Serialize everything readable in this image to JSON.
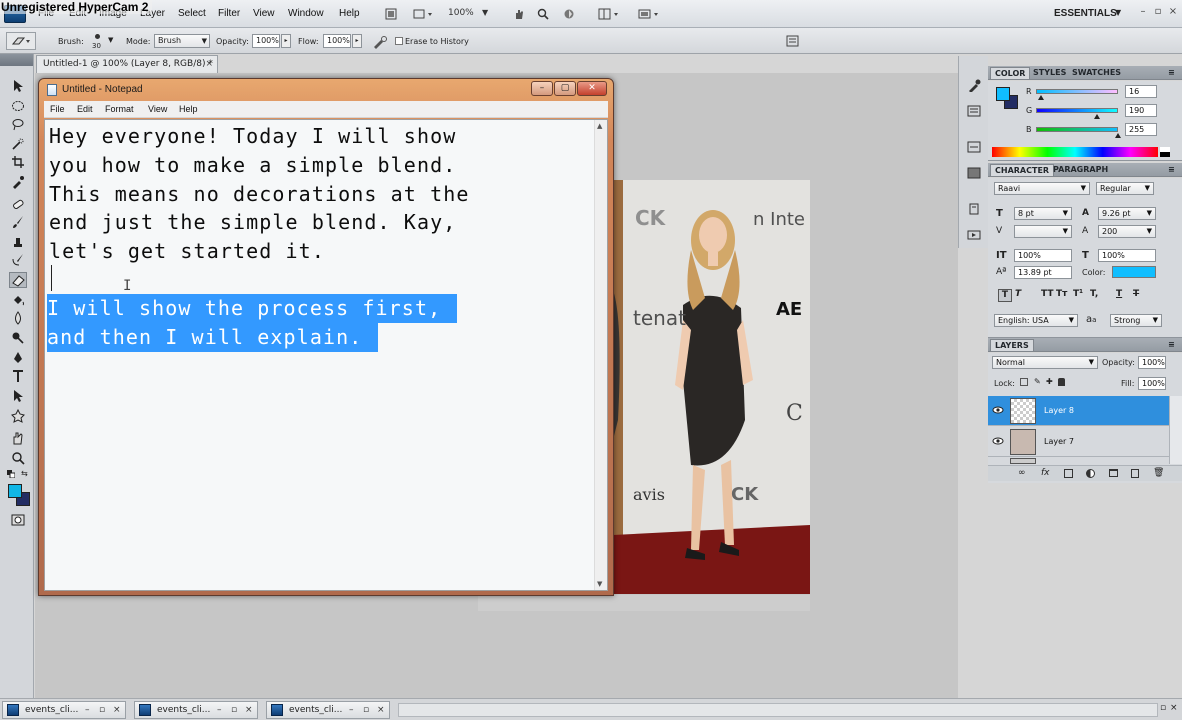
{
  "watermark": "Unregistered HyperCam 2",
  "ps_menus": [
    "File",
    "Edit",
    "Image",
    "Layer",
    "Select",
    "Filter",
    "View",
    "Window",
    "Help"
  ],
  "appbar": {
    "zoom": "100%",
    "workspace": "ESSENTIALS"
  },
  "options": {
    "brush_label": "Brush:",
    "brush_size": "30",
    "mode_label": "Mode:",
    "mode_value": "Brush",
    "opacity_label": "Opacity:",
    "opacity_value": "100%",
    "flow_label": "Flow:",
    "flow_value": "100%",
    "erase_history_label": "Erase to History"
  },
  "document_tab": {
    "title": "Untitled-1 @ 100% (Layer 8, RGB/8) *",
    "close": "×"
  },
  "notepad": {
    "title": "Untitled - Notepad",
    "menus": [
      "File",
      "Edit",
      "Format",
      "View",
      "Help"
    ],
    "text": "Hey everyone! Today I will show\nyou how to make a simple blend.\nThis means no decorations at the\nend just the simple blend. Kay,\nlet's get started it.",
    "selected_lines": [
      "I will show the process first,",
      "and then I will explain."
    ]
  },
  "color_panel": {
    "tabs": [
      "COLOR",
      "STYLES",
      "SWATCHES"
    ],
    "r_label": "R",
    "r_value": "16",
    "g_label": "G",
    "g_value": "190",
    "b_label": "B",
    "b_value": "255",
    "r_level": 16,
    "g_level": 190,
    "b_level": 255,
    "foreground_color": "#10beff"
  },
  "character_panel": {
    "tabs": [
      "CHARACTER",
      "PARAGRAPH"
    ],
    "font_family": "Raavi",
    "font_style": "Regular",
    "size": "8 pt",
    "leading": "9.26 pt",
    "tracking": "200",
    "vscale": "100%",
    "hscale": "100%",
    "baseline": "13.89 pt",
    "color_label": "Color:",
    "text_color": "#10beff",
    "style_buttons": [
      "T",
      "T",
      "TT",
      "Tт",
      "T¹",
      "T,",
      "T",
      "T"
    ],
    "language": "English: USA",
    "aa_label": "a",
    "antialias": "Strong"
  },
  "layers_panel": {
    "tab": "LAYERS",
    "blend_mode": "Normal",
    "opacity_label": "Opacity:",
    "opacity": "100%",
    "lock_label": "Lock:",
    "fill_label": "Fill:",
    "fill": "100%",
    "layers": [
      {
        "name": "Layer 8",
        "selected": true
      },
      {
        "name": "Layer 7",
        "selected": false
      }
    ]
  },
  "taskbar": {
    "tasks": [
      "events_cli...",
      "events_cli...",
      "events_cli..."
    ]
  },
  "colors": {
    "selection": "#3399ff",
    "layer_selected": "#2f8fdd",
    "notepad_frame": "#d38659"
  }
}
